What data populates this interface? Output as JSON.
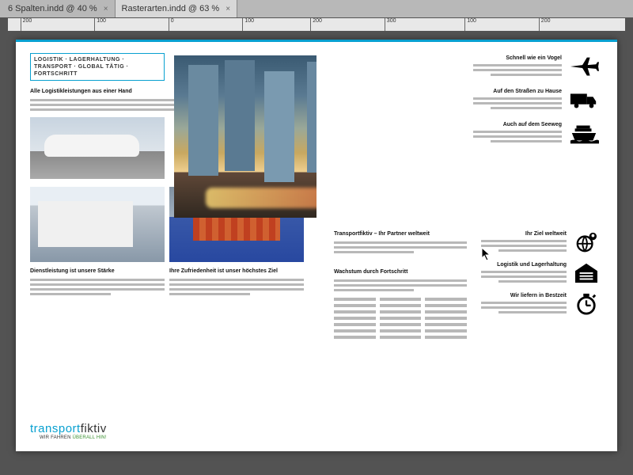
{
  "tabs": [
    {
      "label": "6 Spalten.indd @ 40 %",
      "active": false
    },
    {
      "label": "Rasterarten.indd @ 63 %",
      "active": true
    }
  ],
  "ruler_marks": [
    "200",
    "100",
    "0",
    "100",
    "200",
    "300",
    "100",
    "200"
  ],
  "left_page": {
    "tagbox": "LOGISTIK · LAGERHALTUNG · TRANSPORT · GLOBAL TÄTIG · FORTSCHRITT",
    "h1": "Alle Logistikleistungen aus einer Hand",
    "h2": "Dienstleistung ist unsere Stärke",
    "h3": "Ihre Zufriedenheit ist unser höchstes Ziel"
  },
  "right_page": {
    "items_top": [
      {
        "title": "Schnell wie ein Vogel",
        "icon": "airplane-icon"
      },
      {
        "title": "Auf den Straßen zu Hause",
        "icon": "truck-icon"
      },
      {
        "title": "Auch auf dem Seeweg",
        "icon": "ship-icon"
      }
    ],
    "partner": "Transportfiktiv – Ihr Partner weltweit",
    "growth": "Wachstum durch Fortschritt",
    "items_bottom": [
      {
        "title": "Ihr Ziel weltweit",
        "icon": "globe-pin-icon"
      },
      {
        "title": "Logistik und Lagerhaltung",
        "icon": "warehouse-icon"
      },
      {
        "title": "Wir liefern in Bestzeit",
        "icon": "stopwatch-icon"
      }
    ]
  },
  "logo": {
    "a": "transport",
    "b": "fiktiv",
    "tagline": "WIR FAHREN ",
    "tagline_em": "ÜBERALL HIN!"
  }
}
